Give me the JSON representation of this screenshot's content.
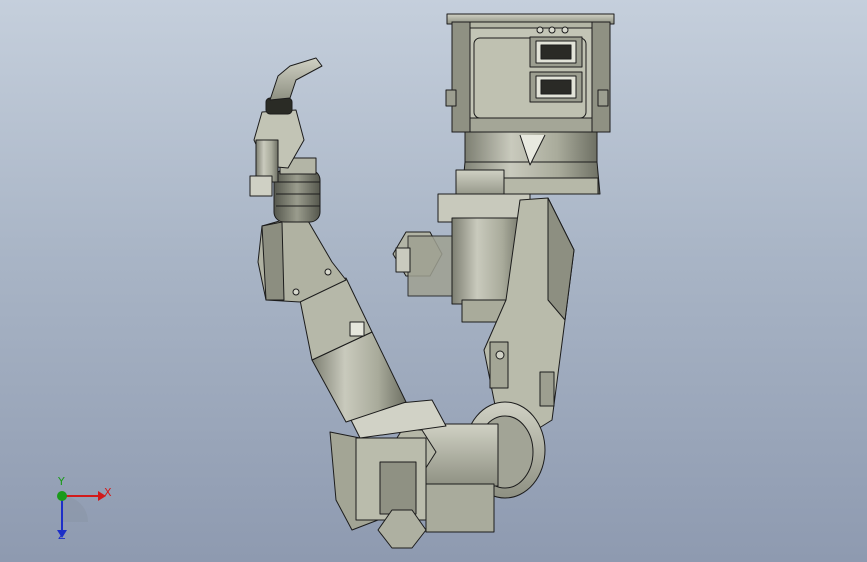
{
  "viewport": {
    "background_top": "#c5cfdc",
    "background_bottom": "#8e9ab0",
    "model": {
      "name": "robot-welding-arm",
      "shade_color": "#a8aa98",
      "edge_color": "#1c1c1c"
    }
  },
  "triad": {
    "x_label": "X",
    "y_label": "Y",
    "z_label": "Z",
    "x_color": "#d21a1a",
    "y_color": "#1a9a1a",
    "z_color": "#1d2fc8"
  }
}
